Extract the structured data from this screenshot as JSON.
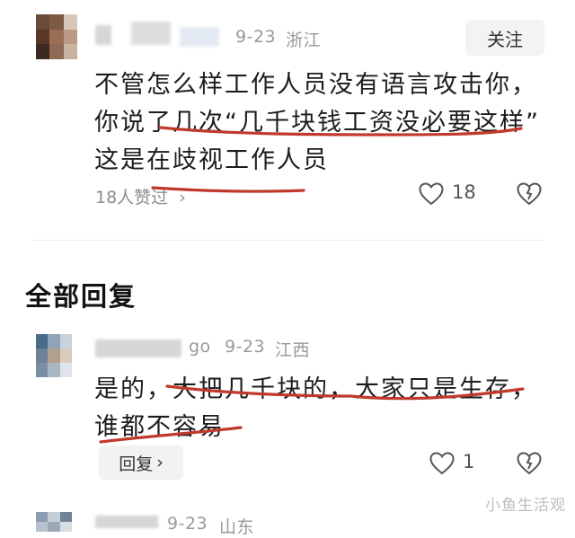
{
  "comment1": {
    "username": "",
    "date": "9-23",
    "location": "浙江",
    "follow_label": "关注",
    "lines": [
      "不管怎么样工作人员没有语言攻击你，",
      "你说了几次“几千块钱工资没必要这样”",
      "这是在歧视工作人员"
    ],
    "likes_summary": "18人赞过",
    "like_count": "18"
  },
  "section": {
    "title": "全部回复"
  },
  "reply1": {
    "username_suffix": "go",
    "date": "9-23",
    "location": "江西",
    "lines": [
      "是的，大把几千块的，大家只是生存，",
      "谁都不容易"
    ],
    "reply_label": "回复",
    "like_count": "1"
  },
  "reply2": {
    "date": "9-23",
    "location": "山东"
  },
  "watermark": "小鱼生活观",
  "colors": {
    "annotation": "#c0392b",
    "meta": "#999999"
  },
  "icons": [
    "heart-icon",
    "dislike-heart-icon",
    "chevron-right-icon"
  ]
}
